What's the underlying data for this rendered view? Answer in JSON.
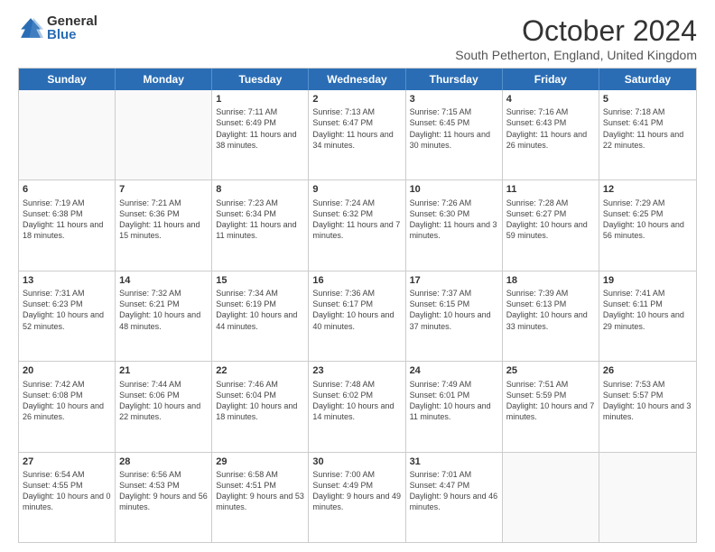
{
  "logo": {
    "general": "General",
    "blue": "Blue"
  },
  "title": "October 2024",
  "subtitle": "South Petherton, England, United Kingdom",
  "days": [
    "Sunday",
    "Monday",
    "Tuesday",
    "Wednesday",
    "Thursday",
    "Friday",
    "Saturday"
  ],
  "weeks": [
    [
      {
        "day": "",
        "text": ""
      },
      {
        "day": "",
        "text": ""
      },
      {
        "day": "1",
        "text": "Sunrise: 7:11 AM\nSunset: 6:49 PM\nDaylight: 11 hours and 38 minutes."
      },
      {
        "day": "2",
        "text": "Sunrise: 7:13 AM\nSunset: 6:47 PM\nDaylight: 11 hours and 34 minutes."
      },
      {
        "day": "3",
        "text": "Sunrise: 7:15 AM\nSunset: 6:45 PM\nDaylight: 11 hours and 30 minutes."
      },
      {
        "day": "4",
        "text": "Sunrise: 7:16 AM\nSunset: 6:43 PM\nDaylight: 11 hours and 26 minutes."
      },
      {
        "day": "5",
        "text": "Sunrise: 7:18 AM\nSunset: 6:41 PM\nDaylight: 11 hours and 22 minutes."
      }
    ],
    [
      {
        "day": "6",
        "text": "Sunrise: 7:19 AM\nSunset: 6:38 PM\nDaylight: 11 hours and 18 minutes."
      },
      {
        "day": "7",
        "text": "Sunrise: 7:21 AM\nSunset: 6:36 PM\nDaylight: 11 hours and 15 minutes."
      },
      {
        "day": "8",
        "text": "Sunrise: 7:23 AM\nSunset: 6:34 PM\nDaylight: 11 hours and 11 minutes."
      },
      {
        "day": "9",
        "text": "Sunrise: 7:24 AM\nSunset: 6:32 PM\nDaylight: 11 hours and 7 minutes."
      },
      {
        "day": "10",
        "text": "Sunrise: 7:26 AM\nSunset: 6:30 PM\nDaylight: 11 hours and 3 minutes."
      },
      {
        "day": "11",
        "text": "Sunrise: 7:28 AM\nSunset: 6:27 PM\nDaylight: 10 hours and 59 minutes."
      },
      {
        "day": "12",
        "text": "Sunrise: 7:29 AM\nSunset: 6:25 PM\nDaylight: 10 hours and 56 minutes."
      }
    ],
    [
      {
        "day": "13",
        "text": "Sunrise: 7:31 AM\nSunset: 6:23 PM\nDaylight: 10 hours and 52 minutes."
      },
      {
        "day": "14",
        "text": "Sunrise: 7:32 AM\nSunset: 6:21 PM\nDaylight: 10 hours and 48 minutes."
      },
      {
        "day": "15",
        "text": "Sunrise: 7:34 AM\nSunset: 6:19 PM\nDaylight: 10 hours and 44 minutes."
      },
      {
        "day": "16",
        "text": "Sunrise: 7:36 AM\nSunset: 6:17 PM\nDaylight: 10 hours and 40 minutes."
      },
      {
        "day": "17",
        "text": "Sunrise: 7:37 AM\nSunset: 6:15 PM\nDaylight: 10 hours and 37 minutes."
      },
      {
        "day": "18",
        "text": "Sunrise: 7:39 AM\nSunset: 6:13 PM\nDaylight: 10 hours and 33 minutes."
      },
      {
        "day": "19",
        "text": "Sunrise: 7:41 AM\nSunset: 6:11 PM\nDaylight: 10 hours and 29 minutes."
      }
    ],
    [
      {
        "day": "20",
        "text": "Sunrise: 7:42 AM\nSunset: 6:08 PM\nDaylight: 10 hours and 26 minutes."
      },
      {
        "day": "21",
        "text": "Sunrise: 7:44 AM\nSunset: 6:06 PM\nDaylight: 10 hours and 22 minutes."
      },
      {
        "day": "22",
        "text": "Sunrise: 7:46 AM\nSunset: 6:04 PM\nDaylight: 10 hours and 18 minutes."
      },
      {
        "day": "23",
        "text": "Sunrise: 7:48 AM\nSunset: 6:02 PM\nDaylight: 10 hours and 14 minutes."
      },
      {
        "day": "24",
        "text": "Sunrise: 7:49 AM\nSunset: 6:01 PM\nDaylight: 10 hours and 11 minutes."
      },
      {
        "day": "25",
        "text": "Sunrise: 7:51 AM\nSunset: 5:59 PM\nDaylight: 10 hours and 7 minutes."
      },
      {
        "day": "26",
        "text": "Sunrise: 7:53 AM\nSunset: 5:57 PM\nDaylight: 10 hours and 3 minutes."
      }
    ],
    [
      {
        "day": "27",
        "text": "Sunrise: 6:54 AM\nSunset: 4:55 PM\nDaylight: 10 hours and 0 minutes."
      },
      {
        "day": "28",
        "text": "Sunrise: 6:56 AM\nSunset: 4:53 PM\nDaylight: 9 hours and 56 minutes."
      },
      {
        "day": "29",
        "text": "Sunrise: 6:58 AM\nSunset: 4:51 PM\nDaylight: 9 hours and 53 minutes."
      },
      {
        "day": "30",
        "text": "Sunrise: 7:00 AM\nSunset: 4:49 PM\nDaylight: 9 hours and 49 minutes."
      },
      {
        "day": "31",
        "text": "Sunrise: 7:01 AM\nSunset: 4:47 PM\nDaylight: 9 hours and 46 minutes."
      },
      {
        "day": "",
        "text": ""
      },
      {
        "day": "",
        "text": ""
      }
    ]
  ]
}
